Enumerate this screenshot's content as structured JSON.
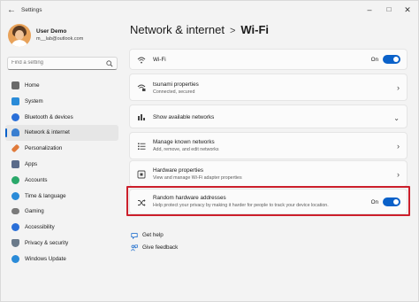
{
  "window": {
    "title": "Settings"
  },
  "user": {
    "name": "User Demo",
    "email": "m__lab@outlook.com"
  },
  "search": {
    "placeholder": "Find a setting"
  },
  "sidebar": {
    "items": [
      {
        "label": "Home",
        "icon": "home-icon",
        "color": "#6a6a6a"
      },
      {
        "label": "System",
        "icon": "system-icon",
        "color": "#2a8bd8"
      },
      {
        "label": "Bluetooth & devices",
        "icon": "bluetooth-icon",
        "color": "#2a6fd8"
      },
      {
        "label": "Network & internet",
        "icon": "network-icon",
        "color": "#3a7fd0",
        "active": true
      },
      {
        "label": "Personalization",
        "icon": "brush-icon",
        "color": "#e07a3a"
      },
      {
        "label": "Apps",
        "icon": "apps-icon",
        "color": "#5a6b8a"
      },
      {
        "label": "Accounts",
        "icon": "accounts-icon",
        "color": "#2aa86a"
      },
      {
        "label": "Time & language",
        "icon": "clock-globe-icon",
        "color": "#2a8bd8"
      },
      {
        "label": "Gaming",
        "icon": "gaming-icon",
        "color": "#7a7a7a"
      },
      {
        "label": "Accessibility",
        "icon": "accessibility-icon",
        "color": "#2a6fd8"
      },
      {
        "label": "Privacy & security",
        "icon": "shield-icon",
        "color": "#6a7a8a"
      },
      {
        "label": "Windows Update",
        "icon": "update-icon",
        "color": "#2a8bd8"
      }
    ]
  },
  "breadcrumb": {
    "parent": "Network & internet",
    "separator": ">",
    "current": "Wi-Fi"
  },
  "cards": {
    "wifi": {
      "title": "Wi-Fi",
      "state": "On"
    },
    "properties": {
      "title": "tsunami properties",
      "subtitle": "Connected, secured"
    },
    "available": {
      "title": "Show available networks"
    },
    "known": {
      "title": "Manage known networks",
      "subtitle": "Add, remove, and edit networks"
    },
    "hardware": {
      "title": "Hardware properties",
      "subtitle": "View and manage Wi-Fi adapter properties"
    },
    "random": {
      "title": "Random hardware addresses",
      "subtitle": "Help protect your privacy by making it harder for people to track your device location.",
      "state": "On"
    }
  },
  "help": {
    "get_help": "Get help",
    "feedback": "Give feedback"
  },
  "colors": {
    "accent": "#0a61c9",
    "highlight": "#cc1f2b"
  }
}
